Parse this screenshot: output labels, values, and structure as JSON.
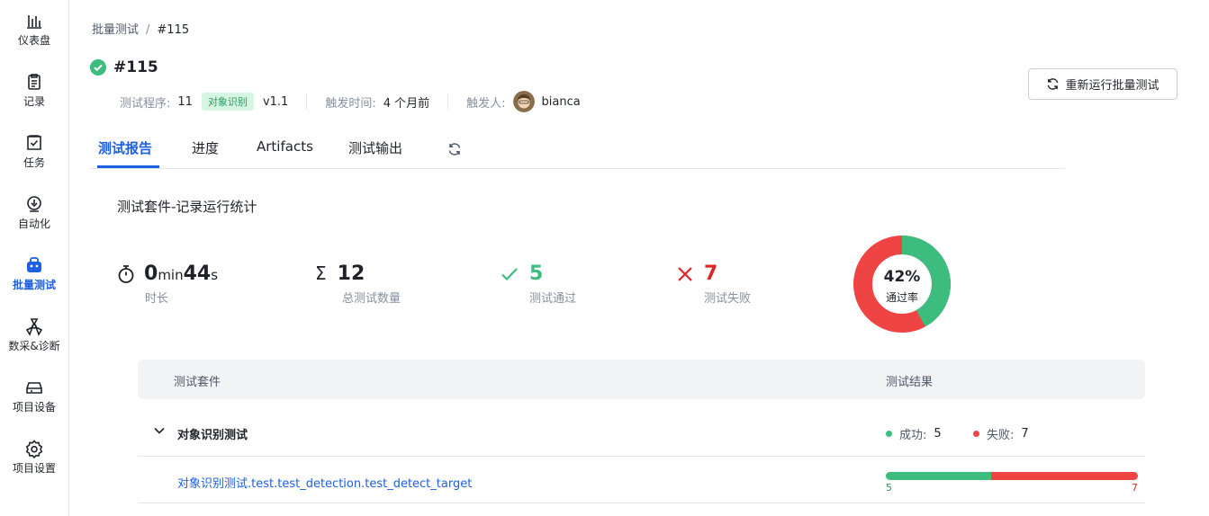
{
  "sidebar": {
    "items": [
      {
        "label": "仪表盘",
        "icon": "bar-chart-icon"
      },
      {
        "label": "记录",
        "icon": "clipboard-icon"
      },
      {
        "label": "任务",
        "icon": "task-check-icon"
      },
      {
        "label": "自动化",
        "icon": "automation-icon"
      },
      {
        "label": "批量测试",
        "icon": "batch-test-icon",
        "active": true
      },
      {
        "label": "数采&诊断",
        "icon": "diagnosis-icon"
      },
      {
        "label": "项目设备",
        "icon": "device-icon"
      },
      {
        "label": "项目设置",
        "icon": "gear-icon"
      }
    ]
  },
  "breadcrumb": {
    "parent": "批量测试",
    "separator": "/",
    "current": "#115"
  },
  "title": "#115",
  "meta": {
    "program_key": "测试程序:",
    "program_id": "11",
    "program_tag": "对象识别",
    "program_version": "v1.1",
    "trigger_time_key": "触发时间:",
    "trigger_time": "4 个月前",
    "trigger_user_key": "触发人:",
    "trigger_user": "bianca"
  },
  "rerun_label": "重新运行批量测试",
  "tabs": [
    {
      "label": "测试报告",
      "active": true
    },
    {
      "label": "进度"
    },
    {
      "label": "Artifacts"
    },
    {
      "label": "测试输出"
    }
  ],
  "section_title": "测试套件-记录运行统计",
  "stats": {
    "duration_min": "0",
    "duration_min_unit": "min",
    "duration_sec": "44",
    "duration_sec_unit": "s",
    "duration_label": "时长",
    "total": "12",
    "total_label": "总测试数量",
    "passed": "5",
    "passed_label": "测试通过",
    "failed": "7",
    "failed_label": "测试失败"
  },
  "pass_rate": {
    "value": "42%",
    "label": "通过率",
    "fraction": 0.42
  },
  "table": {
    "col_suite": "测试套件",
    "col_result": "测试结果",
    "group": {
      "name": "对象识别测试",
      "success_key": "成功:",
      "success": "5",
      "fail_key": "失败:",
      "fail": "7"
    },
    "cases": [
      {
        "name": "对象识别测试.test.test_detection.test_detect_target",
        "success": 5,
        "fail": 7,
        "success_label": "5",
        "fail_label": "7"
      }
    ]
  },
  "colors": {
    "accent": "#1d5fe0",
    "success": "#3dbd7d",
    "fail": "#ef4444"
  }
}
